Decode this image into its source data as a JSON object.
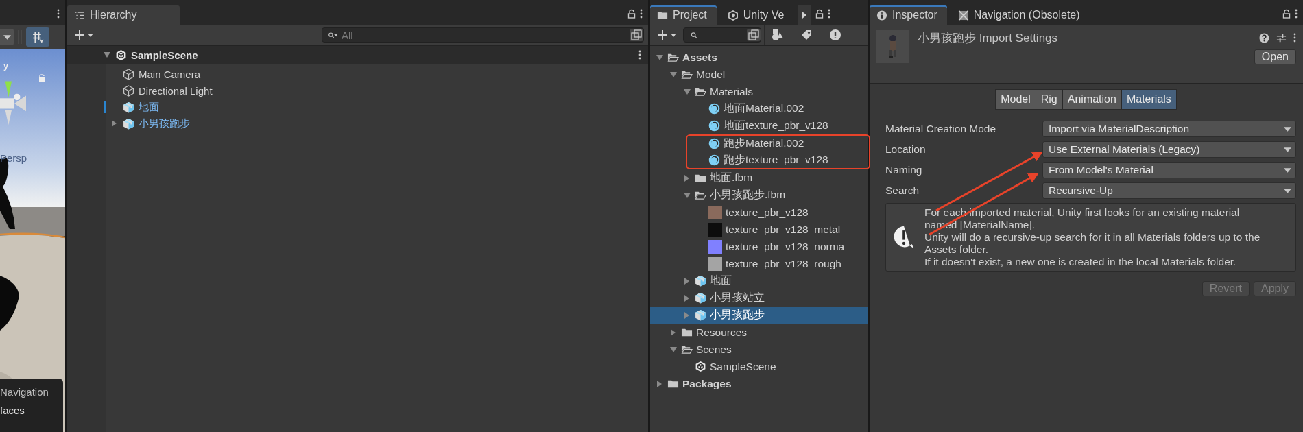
{
  "scene_view": {
    "axis_label": "y",
    "projection_label": "Persp",
    "overlay_lines": [
      "Navigation",
      "faces"
    ]
  },
  "hierarchy": {
    "tab": "Hierarchy",
    "search_placeholder": "All",
    "scene": {
      "label": "SampleScene",
      "expanded": true
    },
    "items": [
      {
        "label": "Main Camera",
        "kind": "object",
        "marked": false
      },
      {
        "label": "Directional Light",
        "kind": "object",
        "marked": false
      },
      {
        "label": "地面",
        "kind": "prefab",
        "marked": true
      },
      {
        "label": "小男孩跑步",
        "kind": "prefab",
        "expanded": false,
        "marked": false
      }
    ]
  },
  "project": {
    "tabs": [
      {
        "label": "Project",
        "selected": true
      },
      {
        "label": "Unity Ve",
        "selected": false
      }
    ],
    "tree": [
      {
        "label": "Assets",
        "kind": "folder",
        "expanded": true,
        "selected": false,
        "boxed": false,
        "children": [
          {
            "label": "Model",
            "kind": "folder",
            "expanded": true,
            "selected": false,
            "boxed": false,
            "children": [
              {
                "label": "Materials",
                "kind": "folder",
                "expanded": true,
                "selected": false,
                "boxed": false,
                "children": [
                  {
                    "label": "地面Material.002",
                    "kind": "material",
                    "selected": false,
                    "boxed": false
                  },
                  {
                    "label": "地面texture_pbr_v128",
                    "kind": "material",
                    "selected": false,
                    "boxed": false
                  },
                  {
                    "label": "跑步Material.002",
                    "kind": "material",
                    "selected": false,
                    "boxed": true
                  },
                  {
                    "label": "跑步texture_pbr_v128",
                    "kind": "material",
                    "selected": false,
                    "boxed": true
                  }
                ]
              },
              {
                "label": "地面.fbm",
                "kind": "folder",
                "expanded": false,
                "selected": false,
                "boxed": false
              },
              {
                "label": "小男孩跑步.fbm",
                "kind": "folder",
                "expanded": true,
                "selected": false,
                "boxed": false,
                "children": [
                  {
                    "label": "texture_pbr_v128",
                    "kind": "texture",
                    "color": "#8a6a5c",
                    "selected": false,
                    "boxed": false
                  },
                  {
                    "label": "texture_pbr_v128_metal",
                    "kind": "texture",
                    "color": "#0d0d0d",
                    "selected": false,
                    "boxed": false
                  },
                  {
                    "label": "texture_pbr_v128_norma",
                    "kind": "texture",
                    "color": "#8080ff",
                    "selected": false,
                    "boxed": false
                  },
                  {
                    "label": "texture_pbr_v128_rough",
                    "kind": "texture",
                    "color": "#a4a4a4",
                    "selected": false,
                    "boxed": false
                  }
                ]
              },
              {
                "label": "地面",
                "kind": "prefab",
                "expanded": false,
                "selected": false,
                "boxed": false
              },
              {
                "label": "小男孩站立",
                "kind": "prefab",
                "expanded": false,
                "selected": false,
                "boxed": false
              },
              {
                "label": "小男孩跑步",
                "kind": "prefab",
                "expanded": false,
                "selected": true,
                "boxed": false
              }
            ]
          },
          {
            "label": "Resources",
            "kind": "folder",
            "expanded": false,
            "selected": false,
            "boxed": false
          },
          {
            "label": "Scenes",
            "kind": "folder",
            "expanded": true,
            "selected": false,
            "boxed": false,
            "children": [
              {
                "label": "SampleScene",
                "kind": "scene",
                "selected": false,
                "boxed": false
              }
            ]
          }
        ]
      },
      {
        "label": "Packages",
        "kind": "folder",
        "expanded": false,
        "selected": false,
        "boxed": false
      }
    ]
  },
  "inspector": {
    "tabs": [
      {
        "label": "Inspector",
        "selected": true
      },
      {
        "label": "Navigation (Obsolete)",
        "selected": false
      }
    ],
    "title": "小男孩跑步 Import Settings",
    "open_button": "Open",
    "section_tabs": [
      {
        "label": "Model",
        "selected": false
      },
      {
        "label": "Rig",
        "selected": false
      },
      {
        "label": "Animation",
        "selected": false
      },
      {
        "label": "Materials",
        "selected": true
      }
    ],
    "fields": [
      {
        "label": "Material Creation Mode",
        "value": "Import via MaterialDescription"
      },
      {
        "label": "Location",
        "value": "Use External Materials (Legacy)"
      },
      {
        "label": "Naming",
        "value": "From Model's Material"
      },
      {
        "label": "Search",
        "value": "Recursive-Up"
      }
    ],
    "help_text": [
      "For each imported material, Unity first looks for an existing material named [MaterialName].",
      "Unity will do a recursive-up search for it in all Materials folders up to the Assets folder.",
      "If it doesn't exist, a new one is created in the local Materials folder."
    ],
    "buttons": [
      {
        "label": "Revert",
        "disabled": true
      },
      {
        "label": "Apply",
        "disabled": true
      }
    ]
  }
}
